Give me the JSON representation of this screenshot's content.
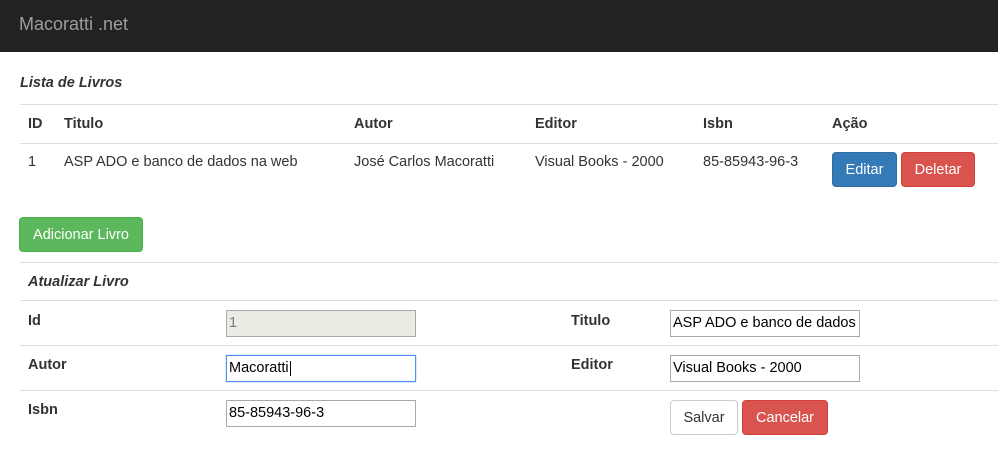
{
  "navbar": {
    "brand": "Macoratti .net"
  },
  "list": {
    "title": "Lista de Livros",
    "columns": [
      "ID",
      "Titulo",
      "Autor",
      "Editor",
      "Isbn",
      "Ação"
    ],
    "rows": [
      {
        "id": "1",
        "titulo": "ASP ADO e banco de dados na web",
        "autor": "José Carlos Macoratti",
        "editor": "Visual Books - 2000",
        "isbn": "85-85943-96-3",
        "edit_label": "Editar",
        "delete_label": "Deletar"
      }
    ],
    "add_label": "Adicionar Livro"
  },
  "update": {
    "title": "Atualizar Livro",
    "id_label": "Id",
    "id_value": "1",
    "titulo_label": "Titulo",
    "titulo_value": "ASP ADO e banco de dados",
    "autor_label": "Autor",
    "autor_value": "Macoratti",
    "editor_label": "Editor",
    "editor_value": "Visual Books - 2000",
    "isbn_label": "Isbn",
    "isbn_value": "85-85943-96-3",
    "save_label": "Salvar",
    "cancel_label": "Cancelar"
  },
  "colors": {
    "navbar": "#222222",
    "primary": "#337ab7",
    "danger": "#d9534f",
    "success": "#5cb85c"
  }
}
